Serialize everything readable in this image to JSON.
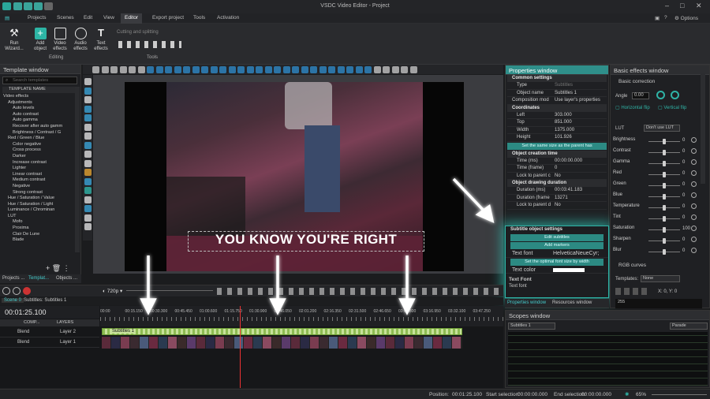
{
  "app": {
    "title": "VSDC Video Editor - Project",
    "options": "Options"
  },
  "menu": [
    "Projects",
    "Scenes",
    "Edit",
    "View",
    "Editor",
    "Export project",
    "Tools",
    "Activation"
  ],
  "ribbon": {
    "run_wizard": "Run Wizard...",
    "add_object": "Add object",
    "video_effects": "Video effects",
    "audio_effects": "Audio effects",
    "text_effects": "Text effects",
    "editing_group": "Editing",
    "cutting": "Cutting and splitting",
    "tools_group": "Tools"
  },
  "template_window": {
    "title": "Template window",
    "search_placeholder": "Search templates",
    "header": "TEMPLATE NAME",
    "items": [
      "Video effects",
      "Adjustments",
      "Auto levels",
      "Auto contrast",
      "Auto gamma",
      "Recover after auto gamm",
      "Brightness / Contrast / G",
      "Red / Green / Blue",
      "Color negative",
      "Cross process",
      "Darker",
      "Increase contrast",
      "Lighter",
      "Linear contrast",
      "Medium contrast",
      "Negative",
      "Strong contrast",
      "Hue / Saturation / Value",
      "Hue / Saturation / Light",
      "Luminance / Chrominan",
      "LUT",
      "Mofo",
      "Proxima",
      "Clair De Lune",
      "Blade"
    ],
    "tabs": [
      "Projects ...",
      "Templat...",
      "Objects ..."
    ]
  },
  "preview": {
    "subtitle": "YOU KNOW YOU'RE RIGHT"
  },
  "properties": {
    "title": "Properties window",
    "common": "Common settings",
    "type_k": "Type",
    "type_v": "Subtitles",
    "name_k": "Object name",
    "name_v": "Subtitles 1",
    "comp_k": "Composition mod",
    "comp_v": "Use layer's properties",
    "coords": "Coordinates",
    "left_k": "Left",
    "left_v": "303.000",
    "top_k": "Top",
    "top_v": "851.000",
    "width_k": "Width",
    "width_v": "1375.000",
    "height_k": "Height",
    "height_v": "101.926",
    "same_size": "Set the same size as the parent has",
    "creation": "Object creation time",
    "time_ms_k": "Time (ms)",
    "time_ms_v": "00:00:00.000",
    "time_fr_k": "Time (frame)",
    "time_fr_v": "0",
    "lock1_k": "Lock to parent c",
    "lock1_v": "No",
    "drawing": "Object drawing duration",
    "dur_ms_k": "Duration (ms)",
    "dur_ms_v": "00:03:41.183",
    "dur_fr_k": "Duration (frame",
    "dur_fr_v": "13271",
    "lock2_k": "Lock to parent d",
    "lock2_v": "No",
    "subtitle_settings": "Subtitle object settings",
    "edit_subtitles": "Edit subtitles",
    "add_markers": "Add markers",
    "text_font_k": "Text font",
    "text_font_v": "HelveticaNeueCyr;",
    "optimal": "Set the optimal font size by width",
    "text_color_k": "Text color",
    "font_section": "Text Font",
    "font_desc": "Text font",
    "tab1": "Properties window",
    "tab2": "Resources window"
  },
  "basic_effects": {
    "title": "Basic effects window",
    "color_correction": "Basic correction",
    "angle": "Angle",
    "angle_v": "0.00",
    "hflip": "Horizontal flip",
    "vflip": "Vertical flip",
    "lut": "LUT",
    "lut_v": "Don't use LUT",
    "sliders": [
      {
        "label": "Brightness",
        "value": "0"
      },
      {
        "label": "Contrast",
        "value": "0"
      },
      {
        "label": "Gamma",
        "value": "0"
      },
      {
        "label": "Red",
        "value": "0"
      },
      {
        "label": "Green",
        "value": "0"
      },
      {
        "label": "Blue",
        "value": "0"
      },
      {
        "label": "Temperature",
        "value": "0"
      },
      {
        "label": "Tint",
        "value": "0"
      },
      {
        "label": "Saturation",
        "value": "100"
      },
      {
        "label": "Sharpen",
        "value": "0"
      },
      {
        "label": "Blur",
        "value": "0"
      }
    ],
    "rgb_curves": "RGB curves",
    "templates": "Templates:",
    "templates_v": "None",
    "xy": "X: 0, Y: 0",
    "curve_v": "255"
  },
  "scopes": {
    "title": "Scopes window",
    "source": "Subtitles 1",
    "mode": "Parade"
  },
  "timeline": {
    "zoom": "720p",
    "tabs": [
      "Scene 0",
      "Subtitles: Subtitles 1"
    ],
    "time": "00:01:25.100",
    "layers_header": "LAYERS",
    "comp": "COMP...",
    "ruler": [
      "00:00",
      "00:15.150",
      "00:30.300",
      "00:45.450",
      "01:00.600",
      "01:15.750",
      "01:30.900",
      "01:46.050",
      "02:01.200",
      "02:16.350",
      "02:31.500",
      "02:46.650",
      "03:01.800",
      "03:16.950",
      "03:32.100",
      "03:47.250"
    ],
    "rows": [
      {
        "blend": "Blend",
        "layer": "Layer 2",
        "clip": "Subtitles 1"
      },
      {
        "blend": "Blend",
        "layer": "Layer 1",
        "clip": ""
      }
    ]
  },
  "status": {
    "position_k": "Position:",
    "position_v": "00:01:25.100",
    "start_k": "Start selection:",
    "start_v": "00:00:00.000",
    "end_k": "End selection:",
    "end_v": "00:00:00.000",
    "zoom": "65%"
  },
  "colors": {
    "accent": "#2fb3a6",
    "arrow": "#ffffff"
  }
}
